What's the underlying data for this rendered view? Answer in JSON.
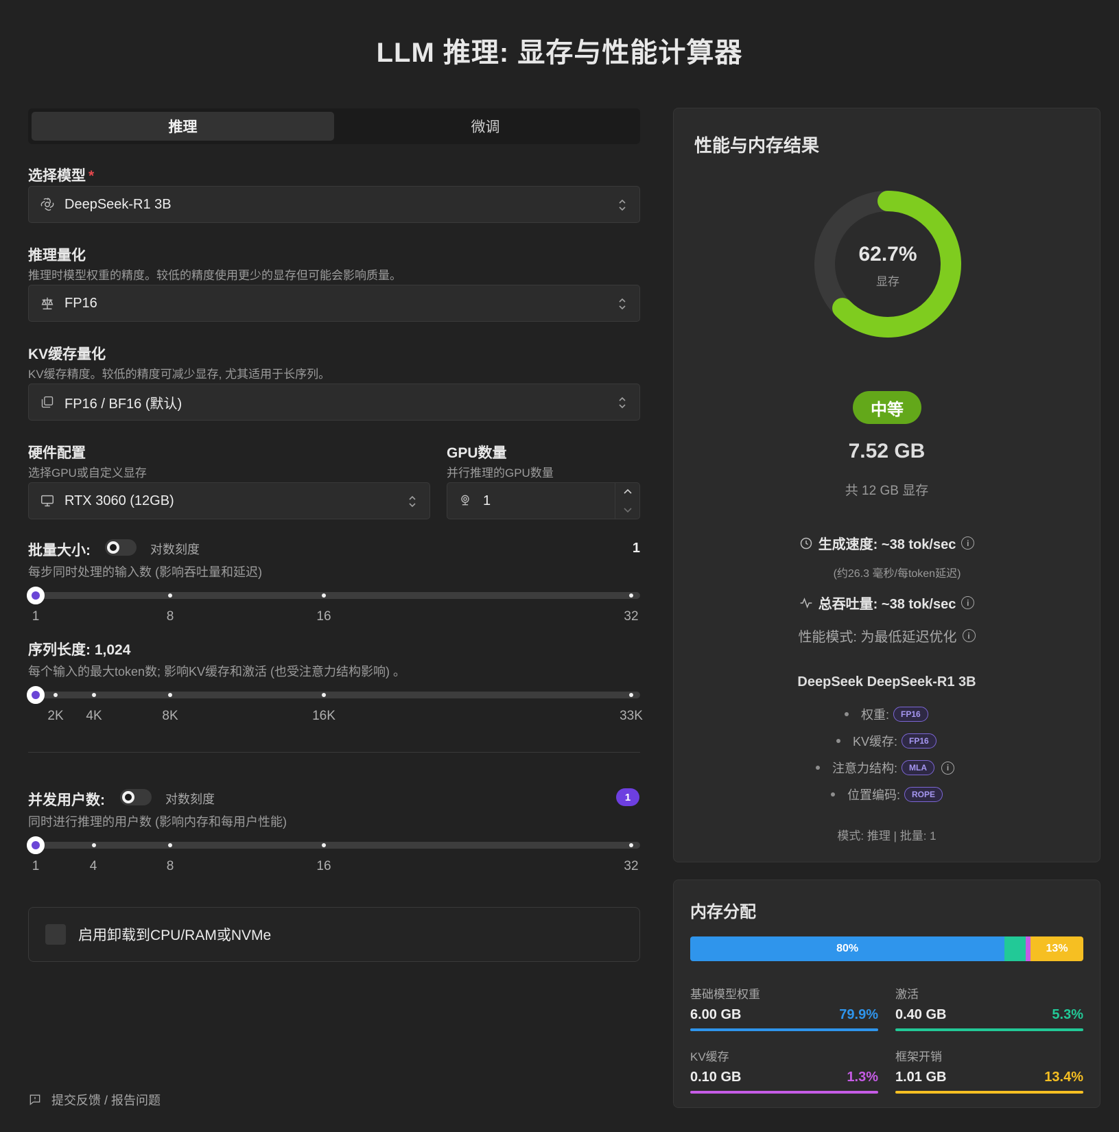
{
  "title": "LLM 推理: 显存与性能计算器",
  "tabs": [
    {
      "label": "推理",
      "active": true
    },
    {
      "label": "微调",
      "active": false
    }
  ],
  "model": {
    "label": "选择模型",
    "required_mark": "*",
    "value": "DeepSeek-R1 3B",
    "icon": "openai-logo-icon"
  },
  "quant": {
    "label": "推理量化",
    "help": "推理时模型权重的精度。较低的精度使用更少的显存但可能会影响质量。",
    "value": "FP16",
    "icon": "scale-icon"
  },
  "kv": {
    "label": "KV缓存量化",
    "help": "KV缓存精度。较低的精度可减少显存, 尤其适用于长序列。",
    "value": "FP16 / BF16 (默认)",
    "icon": "layers-icon"
  },
  "hardware": {
    "label": "硬件配置",
    "help": "选择GPU或自定义显存",
    "value": "RTX 3060 (12GB)",
    "icon": "monitor-icon"
  },
  "gpu_count": {
    "label": "GPU数量",
    "help": "并行推理的GPU数量",
    "value": "1",
    "icon": "gpu-icon"
  },
  "batch": {
    "label": "批量大小:",
    "toggle_label": "对数刻度",
    "toggle_on": false,
    "value": "1",
    "help": "每步同时处理的输入数 (影响吞吐量和延迟)",
    "ticks": [
      "1",
      "8",
      "16",
      "32"
    ]
  },
  "sequence": {
    "label": "序列长度: 1,024",
    "help": "每个输入的最大token数; 影响KV缓存和激活 (也受注意力结构影响) 。",
    "ticks": [
      "2K",
      "4K",
      "8K",
      "16K",
      "33K"
    ]
  },
  "users": {
    "label": "并发用户数:",
    "toggle_label": "对数刻度",
    "toggle_on": false,
    "value": "1",
    "help": "同时进行推理的用户数 (影响内存和每用户性能)",
    "ticks": [
      "1",
      "4",
      "8",
      "16",
      "32"
    ]
  },
  "offload": {
    "label": "启用卸载到CPU/RAM或NVMe",
    "checked": false
  },
  "feedback": {
    "label": "提交反馈 / 报告问题"
  },
  "results": {
    "title": "性能与内存结果",
    "gauge_percent": "62.7%",
    "gauge_fraction": 0.627,
    "gauge_label": "显存",
    "gauge_color": "#7fcc1f",
    "level": "中等",
    "used": "7.52 GB",
    "total": "共 12 GB 显存",
    "gen_speed": "生成速度: ~38 tok/sec",
    "gen_latency": "(约26.3 毫秒/每token延迟)",
    "throughput": "总吞吐量: ~38 tok/sec",
    "mode": "性能模式: 为最低延迟优化",
    "model_name": "DeepSeek DeepSeek-R1 3B",
    "specs": [
      {
        "label": "权重:",
        "tag": "FP16",
        "info": false
      },
      {
        "label": "KV缓存:",
        "tag": "FP16",
        "info": false
      },
      {
        "label": "注意力结构:",
        "tag": "MLA",
        "info": true
      },
      {
        "label": "位置编码:",
        "tag": "ROPE",
        "info": false
      }
    ],
    "footer": "模式: 推理 | 批量: 1"
  },
  "memory": {
    "title": "内存分配",
    "bar_labels": {
      "weights": "80%",
      "overhead": "13%"
    },
    "items": [
      {
        "label": "基础模型权重",
        "value": "6.00 GB",
        "percent": "79.9%",
        "fraction": 0.799,
        "color": "#2f95ec"
      },
      {
        "label": "激活",
        "value": "0.40 GB",
        "percent": "5.3%",
        "fraction": 0.053,
        "color": "#22c997"
      },
      {
        "label": "KV缓存",
        "value": "0.10 GB",
        "percent": "1.3%",
        "fraction": 0.013,
        "color": "#c65ce6"
      },
      {
        "label": "框架开销",
        "value": "1.01 GB",
        "percent": "13.4%",
        "fraction": 0.134,
        "color": "#f6bf22"
      }
    ]
  }
}
